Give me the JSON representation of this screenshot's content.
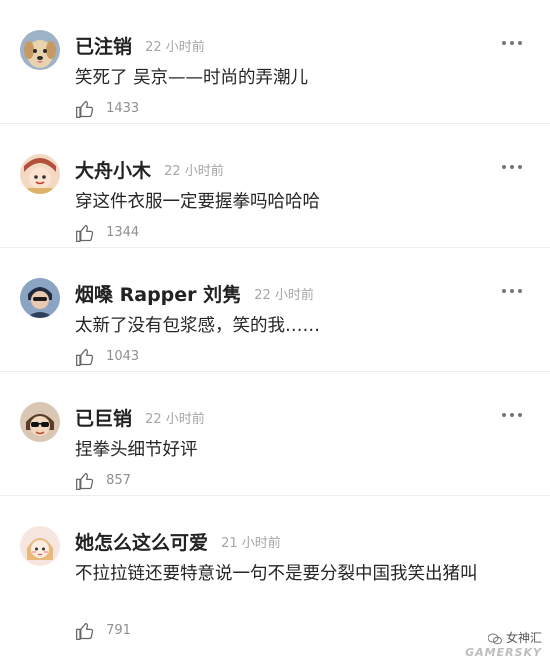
{
  "comments": [
    {
      "username": "已注销",
      "time": "22 小时前",
      "text": "笑死了 吴京——时尚的弄潮儿",
      "likes": "1433",
      "avatar": "golden-retriever-dog-avatar"
    },
    {
      "username": "大舟小木",
      "time": "22 小时前",
      "text": "穿这件衣服一定要握拳吗哈哈哈",
      "likes": "1344",
      "avatar": "cartoon-character-avatar"
    },
    {
      "username": "烟嗓 Rapper 刘隽",
      "time": "22 小时前",
      "text": "太新了没有包浆感，笑的我……",
      "likes": "1043",
      "avatar": "person-photo-avatar"
    },
    {
      "username": "已巨销",
      "time": "22 小时前",
      "text": "捏拳头细节好评",
      "likes": "857",
      "avatar": "sunglasses-person-avatar"
    },
    {
      "username": "她怎么这么可爱",
      "time": "21 小时前",
      "text": "不拉拉链还要特意说一句不是要分裂中国我笑出猪叫",
      "likes": "791",
      "avatar": "cartoon-girl-avatar"
    }
  ],
  "icons": {
    "like": "thumbs-up-icon",
    "more": "more-dots-icon"
  },
  "watermark": {
    "account": "女神汇",
    "brand": "GAMERSKY"
  },
  "colors": {
    "username": "#222222",
    "time": "#a6a6a6",
    "like_count": "#8f8f8f",
    "divider": "#ececec"
  }
}
